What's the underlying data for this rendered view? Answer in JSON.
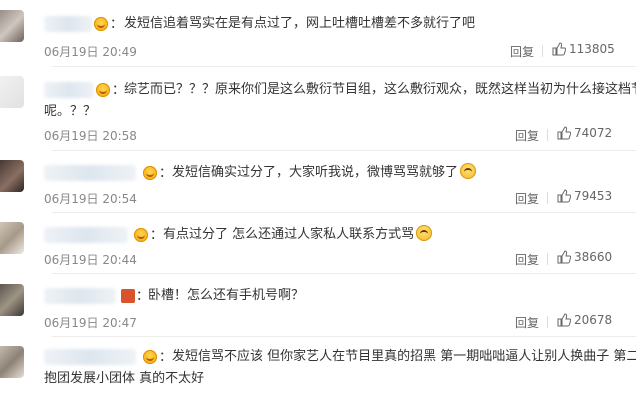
{
  "comments": [
    {
      "text": "发短信追着骂实在是有点过了，网上吐槽吐槽差不多就行了吧",
      "time": "06月19日 20:49",
      "reply": "回复",
      "likes": "113805"
    },
    {
      "text_line1": "综艺而已？？？原来你们是这么敷衍节目组，这么敷衍观众，既然这样当初为什么接这档节目",
      "text_line2": "呢。？？",
      "time": "06月19日 20:58",
      "reply": "回复",
      "likes": "74072"
    },
    {
      "text": "发短信确实过分了，大家听我说，微博骂骂就够了",
      "time": "06月19日 20:54",
      "reply": "回复",
      "likes": "79453"
    },
    {
      "text": "有点过分了 怎么还通过人家私人联系方式骂",
      "time": "06月19日 20:44",
      "reply": "回复",
      "likes": "38660"
    },
    {
      "text": "卧槽！怎么还有手机号啊？",
      "time": "06月19日 20:47",
      "reply": "回复",
      "likes": "20678"
    },
    {
      "text_line1": "发短信骂不应该 但你家艺人在节目里真的招黑 第一期咄咄逼人让别人换曲子 第二期",
      "text_line2": "抱团发展小团体 真的不太好"
    }
  ],
  "colon": "：",
  "icons": {
    "crown": "vip-crown-icon",
    "thumb": "thumb-up-icon",
    "emoji": "smiley-emoji-icon"
  },
  "colors": {
    "text": "#333333",
    "meta": "#888888",
    "crown": "#f2a10c"
  }
}
